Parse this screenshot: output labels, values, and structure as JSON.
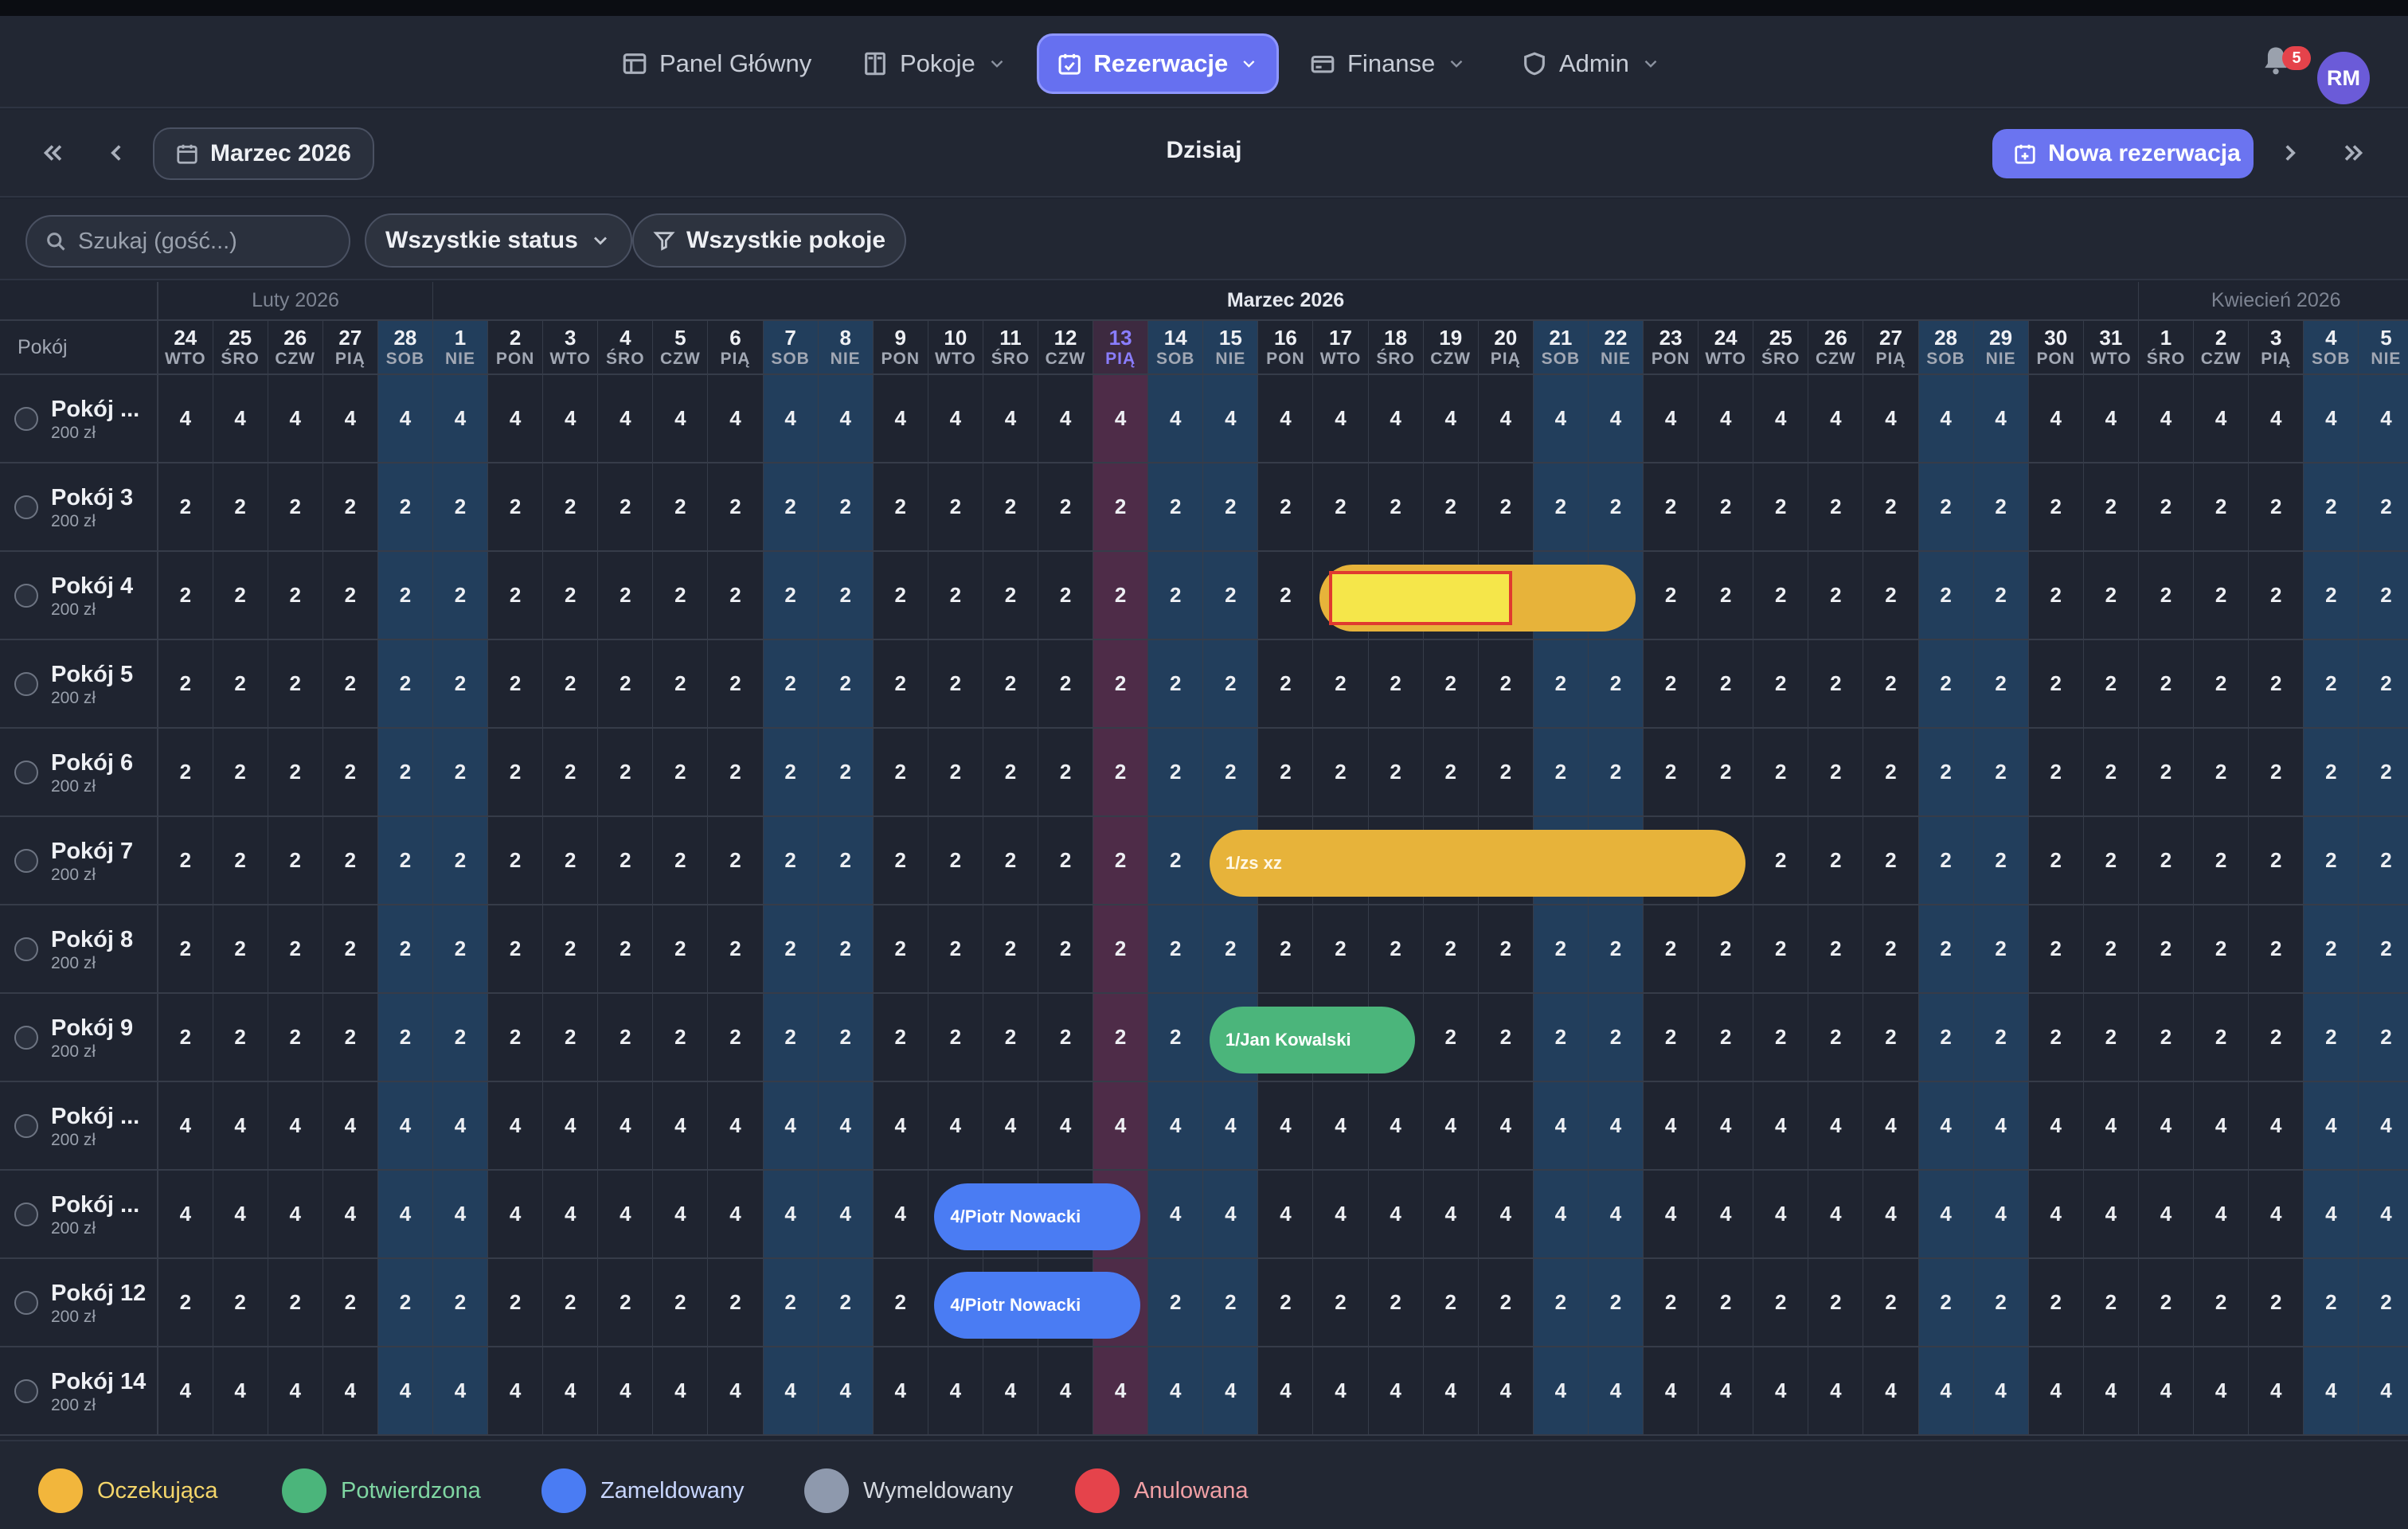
{
  "nav": {
    "items": [
      {
        "label": "Panel Główny",
        "icon": "dashboard-icon",
        "has_chevron": false,
        "active": false
      },
      {
        "label": "Pokoje",
        "icon": "door-icon",
        "has_chevron": true,
        "active": false
      },
      {
        "label": "Rezerwacje",
        "icon": "calendar-check-icon",
        "has_chevron": true,
        "active": true
      },
      {
        "label": "Finanse",
        "icon": "finance-icon",
        "has_chevron": true,
        "active": false
      },
      {
        "label": "Admin",
        "icon": "shield-icon",
        "has_chevron": true,
        "active": false
      }
    ],
    "notifications_count": "5",
    "avatar_initials": "RM"
  },
  "toolbar": {
    "month_label": "Marzec 2026",
    "today_label": "Dzisiaj",
    "new_reservation_label": "Nowa rezerwacja"
  },
  "filters": {
    "search_placeholder": "Szukaj (gość...)",
    "status_label": "Wszystkie status",
    "rooms_label": "Wszystkie pokoje"
  },
  "calendar": {
    "room_header": "Pokój",
    "months": [
      {
        "label": "Luty 2026",
        "days": 5,
        "dim": true
      },
      {
        "label": "Marzec 2026",
        "days": 31,
        "dim": false
      },
      {
        "label": "Kwiecień 2026",
        "days": 5,
        "dim": true
      }
    ],
    "days": [
      {
        "d": "24",
        "w": "WTO"
      },
      {
        "d": "25",
        "w": "ŚRO"
      },
      {
        "d": "26",
        "w": "CZW"
      },
      {
        "d": "27",
        "w": "PIĄ"
      },
      {
        "d": "28",
        "w": "SOB"
      },
      {
        "d": "1",
        "w": "NIE"
      },
      {
        "d": "2",
        "w": "PON"
      },
      {
        "d": "3",
        "w": "WTO"
      },
      {
        "d": "4",
        "w": "ŚRO"
      },
      {
        "d": "5",
        "w": "CZW"
      },
      {
        "d": "6",
        "w": "PIĄ"
      },
      {
        "d": "7",
        "w": "SOB"
      },
      {
        "d": "8",
        "w": "NIE"
      },
      {
        "d": "9",
        "w": "PON"
      },
      {
        "d": "10",
        "w": "WTO"
      },
      {
        "d": "11",
        "w": "ŚRO"
      },
      {
        "d": "12",
        "w": "CZW"
      },
      {
        "d": "13",
        "w": "PIĄ"
      },
      {
        "d": "14",
        "w": "SOB"
      },
      {
        "d": "15",
        "w": "NIE"
      },
      {
        "d": "16",
        "w": "PON"
      },
      {
        "d": "17",
        "w": "WTO"
      },
      {
        "d": "18",
        "w": "ŚRO"
      },
      {
        "d": "19",
        "w": "CZW"
      },
      {
        "d": "20",
        "w": "PIĄ"
      },
      {
        "d": "21",
        "w": "SOB"
      },
      {
        "d": "22",
        "w": "NIE"
      },
      {
        "d": "23",
        "w": "PON"
      },
      {
        "d": "24",
        "w": "WTO"
      },
      {
        "d": "25",
        "w": "ŚRO"
      },
      {
        "d": "26",
        "w": "CZW"
      },
      {
        "d": "27",
        "w": "PIĄ"
      },
      {
        "d": "28",
        "w": "SOB"
      },
      {
        "d": "29",
        "w": "NIE"
      },
      {
        "d": "30",
        "w": "PON"
      },
      {
        "d": "31",
        "w": "WTO"
      },
      {
        "d": "1",
        "w": "ŚRO"
      },
      {
        "d": "2",
        "w": "CZW"
      },
      {
        "d": "3",
        "w": "PIĄ"
      },
      {
        "d": "4",
        "w": "SOB"
      },
      {
        "d": "5",
        "w": "NIE"
      }
    ],
    "today_index": 17,
    "rooms": [
      {
        "name": "Pokój ...",
        "price": "200 zł",
        "cap": "4"
      },
      {
        "name": "Pokój 3",
        "price": "200 zł",
        "cap": "2"
      },
      {
        "name": "Pokój 4",
        "price": "200 zł",
        "cap": "2"
      },
      {
        "name": "Pokój 5",
        "price": "200 zł",
        "cap": "2"
      },
      {
        "name": "Pokój 6",
        "price": "200 zł",
        "cap": "2"
      },
      {
        "name": "Pokój 7",
        "price": "200 zł",
        "cap": "2"
      },
      {
        "name": "Pokój 8",
        "price": "200 zł",
        "cap": "2"
      },
      {
        "name": "Pokój 9",
        "price": "200 zł",
        "cap": "2"
      },
      {
        "name": "Pokój ...",
        "price": "200 zł",
        "cap": "4"
      },
      {
        "name": "Pokój ...",
        "price": "200 zł",
        "cap": "4"
      },
      {
        "name": "Pokój 12",
        "price": "200 zł",
        "cap": "2"
      },
      {
        "name": "Pokój 14",
        "price": "200 zł",
        "cap": "4"
      }
    ],
    "reservations": [
      {
        "room": 2,
        "start": 21,
        "end": 26,
        "label": "",
        "status": "pending",
        "selected": true
      },
      {
        "room": 5,
        "start": 19,
        "end": 28,
        "label": "1/zs xz",
        "status": "pending",
        "selected": false
      },
      {
        "room": 7,
        "start": 19,
        "end": 22,
        "label": "1/Jan Kowalski",
        "status": "confirmed",
        "selected": false
      },
      {
        "room": 9,
        "start": 14,
        "end": 17,
        "label": "4/Piotr Nowacki",
        "status": "checkedin",
        "selected": false
      },
      {
        "room": 10,
        "start": 14,
        "end": 17,
        "label": "4/Piotr Nowacki",
        "status": "checkedin",
        "selected": false
      }
    ]
  },
  "legend": [
    {
      "label": "Oczekująca",
      "color": "#f2b63c",
      "text_color": "#f4d56a"
    },
    {
      "label": "Potwierdzona",
      "color": "#4bb57b",
      "text_color": "#7fd6a2"
    },
    {
      "label": "Zameldowany",
      "color": "#4a7cf3",
      "text_color": "#c8d6ff"
    },
    {
      "label": "Wymeldowany",
      "color": "#8e99ad",
      "text_color": "#d5d9e0"
    },
    {
      "label": "Anulowana",
      "color": "#e5434b",
      "text_color": "#f2a0a5"
    }
  ]
}
